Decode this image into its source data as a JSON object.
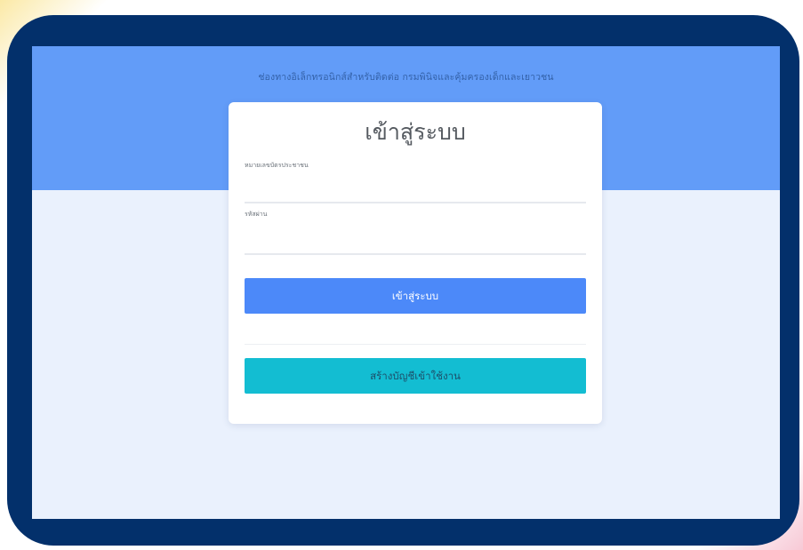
{
  "header": {
    "title": "ช่องทางอิเล็กทรอนิกส์สำหรับติดต่อ กรมพินิจและคุ้มครองเด็กและเยาวชน"
  },
  "login_card": {
    "title": "เข้าสู่ระบบ",
    "id_field": {
      "label": "หมายเลขบัตรประชาชน",
      "value": ""
    },
    "password_field": {
      "label": "รหัสผ่าน",
      "value": ""
    },
    "login_button": "เข้าสู่ระบบ",
    "register_button": "สร้างบัญชีเข้าใช้งาน"
  },
  "colors": {
    "frame": "#03306b",
    "hero": "#629cf8",
    "page_background": "#eaf1fd",
    "login_button": "#4c89f9",
    "register_button": "#13bdd2"
  }
}
